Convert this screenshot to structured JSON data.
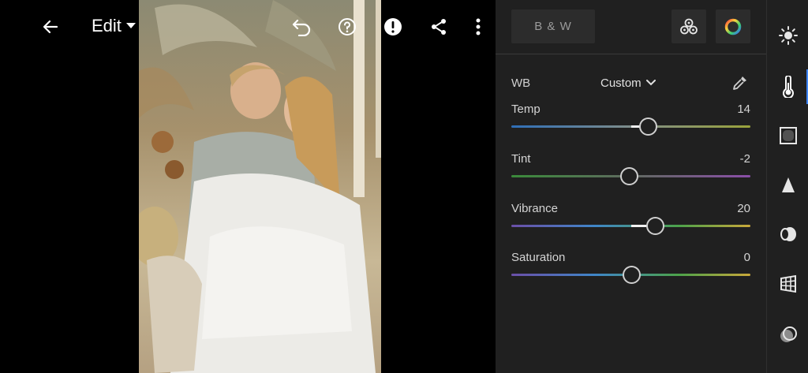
{
  "topbar": {
    "edit_label": "Edit"
  },
  "panel": {
    "bw_label": "B & W",
    "wb": {
      "label": "WB",
      "value": "Custom"
    },
    "sliders": [
      {
        "label": "Temp",
        "value": "14",
        "fraction": 0.572
      },
      {
        "label": "Tint",
        "value": "-2",
        "fraction": 0.492
      },
      {
        "label": "Vibrance",
        "value": "20",
        "fraction": 0.601
      },
      {
        "label": "Saturation",
        "value": "0",
        "fraction": 0.5
      }
    ]
  },
  "rail": {
    "tools": [
      "light-icon",
      "color-icon",
      "effects-icon",
      "detail-icon",
      "optics-icon",
      "geometry-icon",
      "presets-icon"
    ],
    "active_index": 1
  },
  "colors": {
    "panel_bg": "#202020",
    "accent": "#3b83f6",
    "temp_gradient": [
      "#2f6fb8",
      "#9aa33b"
    ],
    "tint_gradient": [
      "#3a8a3a",
      "#8a4ea8"
    ],
    "vibrance_gradient": [
      "#6b4fa8",
      "#3f86c8",
      "#4ca24a",
      "#c9a83a"
    ]
  }
}
